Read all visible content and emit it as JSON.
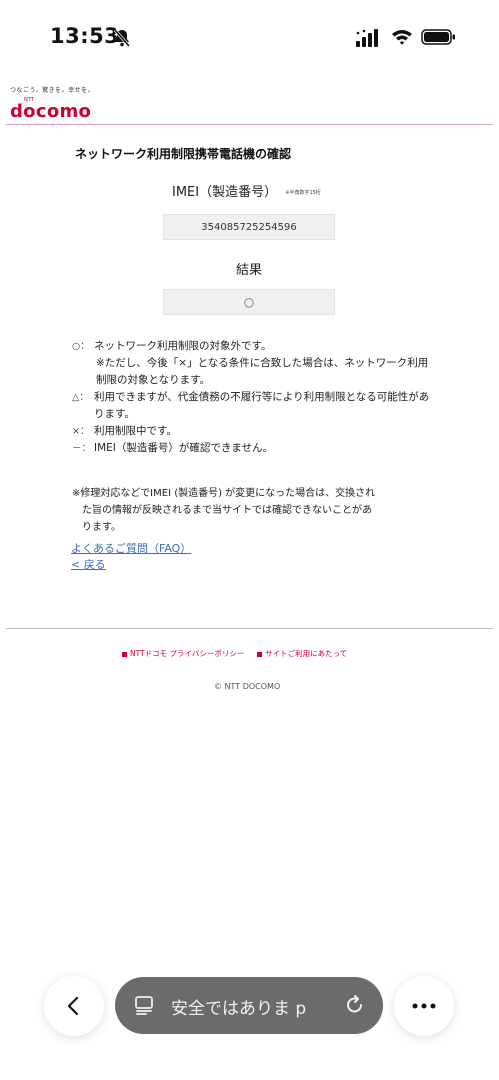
{
  "status_bar": {
    "time": "13:53",
    "icons": [
      "bell-slash-icon",
      "cellular-signal-icon",
      "wifi-icon",
      "battery-icon"
    ]
  },
  "header": {
    "tagline": "つなごう。驚きを。幸せを。",
    "brand_prefix": "NTT",
    "logo_text": "docomo",
    "brand_color": "#cc0033"
  },
  "main": {
    "title": "ネットワーク利用制限携帯電話機の確認",
    "imei_label": "IMEI（製造番号）",
    "imei_note": "※半角数字15桁",
    "imei_value": "354085725254596",
    "result_label": "結果",
    "result_value": "○",
    "legend": [
      {
        "symbol": "○：",
        "text": "ネットワーク利用制限の対象外です。"
      },
      {
        "symbol": "",
        "text": "※ただし、今後「×」となる条件に合致した場合は、ネットワーク利用制限の対象となります。"
      },
      {
        "symbol": "△：",
        "text": "利用できますが、代金債務の不履行等により利用制限となる可能性があります。"
      },
      {
        "symbol": "×：",
        "text": "利用制限中です。"
      },
      {
        "symbol": "－：",
        "text": "IMEI（製造番号）が確認できません。"
      }
    ],
    "footnote_lines": [
      "※修理対応などでIMEI (製造番号) が変更になった場合は、交換され",
      "た旨の情報が反映されるまで当サイトでは確認できないことがあ",
      "ります。"
    ],
    "faq_link": "よくあるご質問（FAQ）",
    "back_link": "< 戻る"
  },
  "footer": {
    "privacy_link": "NTTドコモ プライバシーポリシー",
    "terms_link": "サイトご利用にあたって",
    "copyright": "© NTT DOCOMO"
  },
  "browser_toolbar": {
    "url_text": "安全ではありま p",
    "back_icon": "chevron-left-icon",
    "page_icon": "page-menu-icon",
    "reload_icon": "reload-icon",
    "more_icon": "more-dots-icon"
  }
}
